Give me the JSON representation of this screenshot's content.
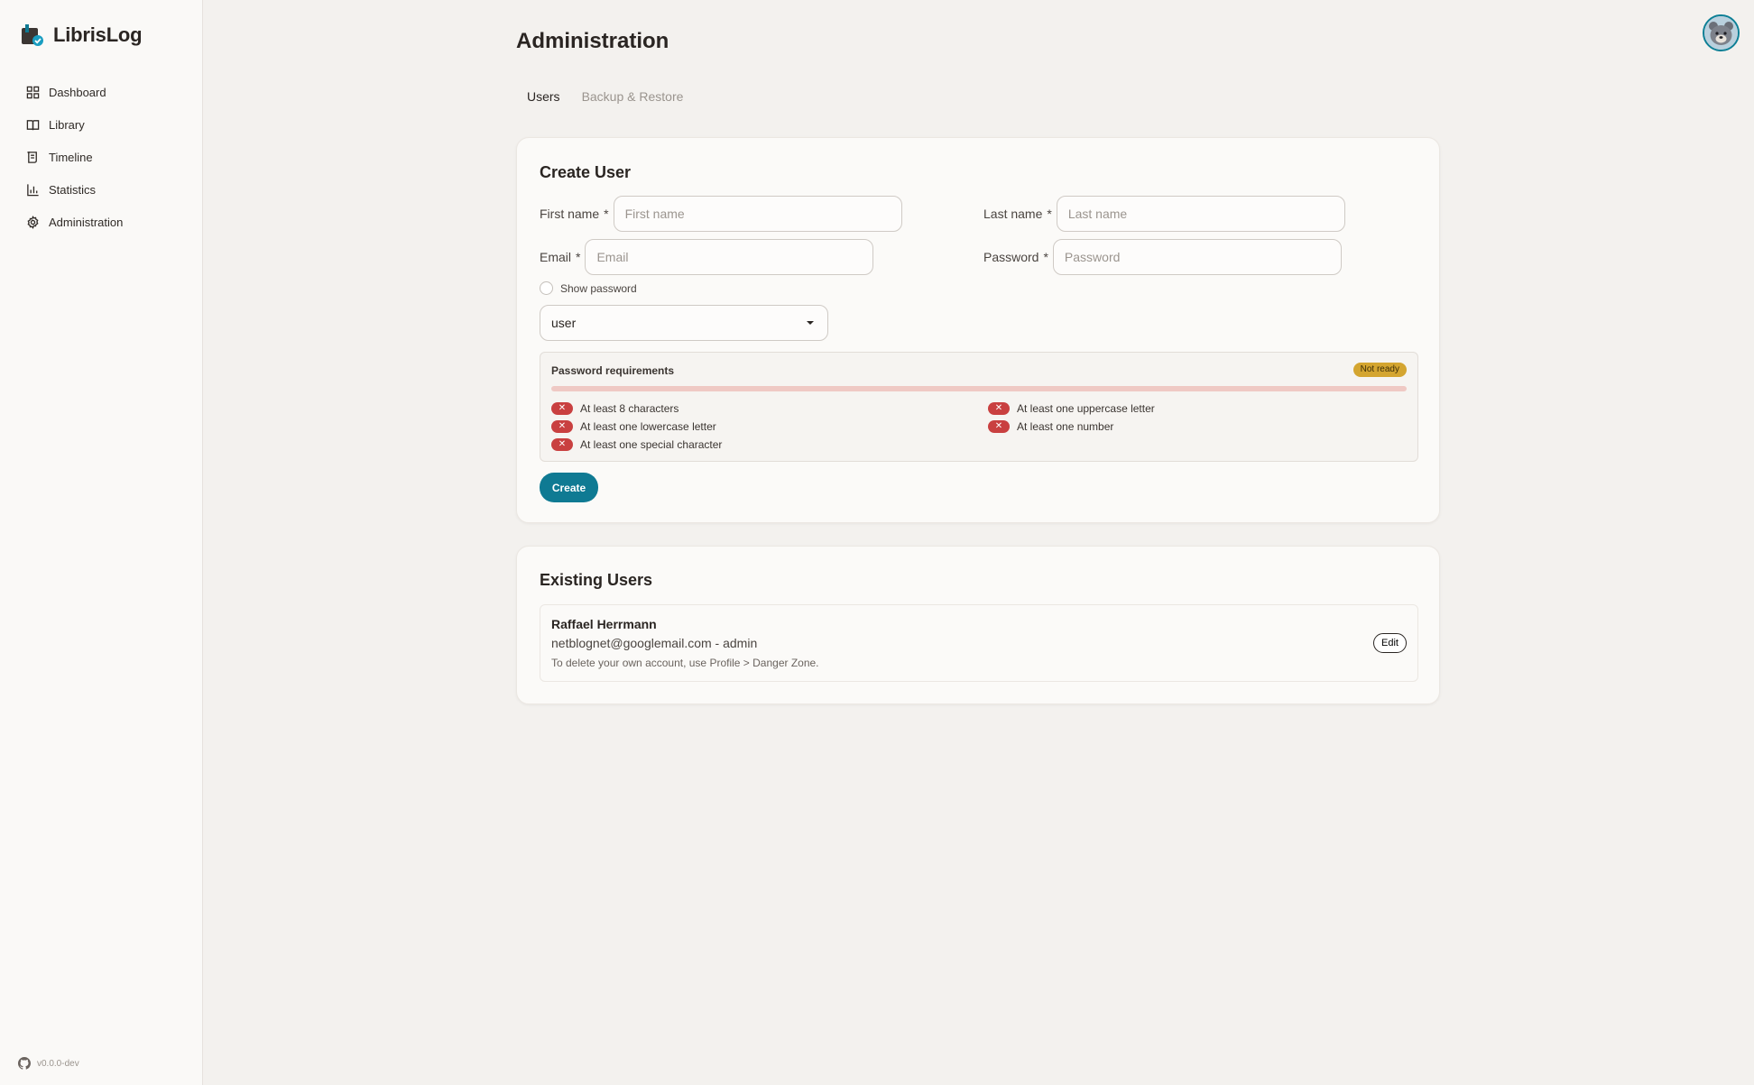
{
  "app": {
    "name": "LibrisLog",
    "version": "v0.0.0-dev"
  },
  "sidebar": {
    "items": [
      {
        "label": "Dashboard",
        "icon": "grid-icon"
      },
      {
        "label": "Library",
        "icon": "book-icon"
      },
      {
        "label": "Timeline",
        "icon": "timeline-icon"
      },
      {
        "label": "Statistics",
        "icon": "bar-chart-icon"
      },
      {
        "label": "Administration",
        "icon": "gear-icon"
      }
    ]
  },
  "header": {
    "avatar_icon": "bear-avatar-icon"
  },
  "page": {
    "title": "Administration",
    "tabs": [
      {
        "label": "Users",
        "active": true
      },
      {
        "label": "Backup & Restore",
        "active": false
      }
    ]
  },
  "create_user": {
    "title": "Create User",
    "first_name": {
      "label": "First name",
      "required": "*",
      "placeholder": "First name",
      "value": ""
    },
    "last_name": {
      "label": "Last name",
      "required": "*",
      "placeholder": "Last name",
      "value": ""
    },
    "email": {
      "label": "Email",
      "required": "*",
      "placeholder": "Email",
      "value": ""
    },
    "password": {
      "label": "Password",
      "required": "*",
      "placeholder": "Password",
      "value": ""
    },
    "show_password": {
      "label": "Show password",
      "checked": false
    },
    "role": {
      "selected": "user"
    },
    "requirements": {
      "title": "Password requirements",
      "status": "Not ready",
      "progress": 0,
      "items": [
        {
          "label": "At least 8 characters",
          "met": false
        },
        {
          "label": "At least one uppercase letter",
          "met": false
        },
        {
          "label": "At least one lowercase letter",
          "met": false
        },
        {
          "label": "At least one number",
          "met": false
        },
        {
          "label": "At least one special character",
          "met": false
        }
      ]
    },
    "submit_label": "Create"
  },
  "existing_users": {
    "title": "Existing Users",
    "users": [
      {
        "name": "Raffael Herrmann",
        "meta": "netblognet@googlemail.com - admin",
        "note": "To delete your own account, use Profile > Danger Zone.",
        "edit_label": "Edit"
      }
    ]
  },
  "colors": {
    "accent": "#0f7a93",
    "warning": "#d4a530",
    "error": "#c94040",
    "background": "#f3f1ee"
  }
}
